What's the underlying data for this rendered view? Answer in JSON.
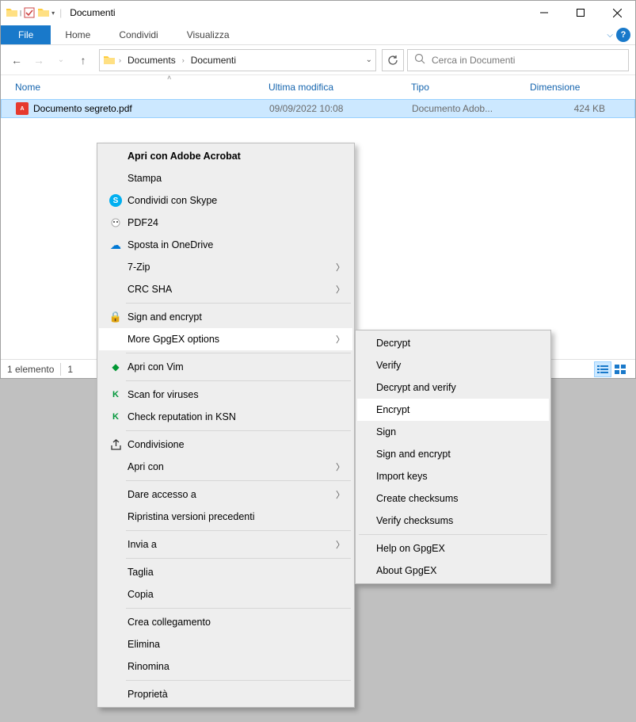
{
  "window": {
    "title": "Documenti",
    "qat_separator": "|"
  },
  "ribbon": {
    "file": "File",
    "tabs": [
      "Home",
      "Condividi",
      "Visualizza"
    ]
  },
  "nav": {
    "breadcrumb": [
      "Documents",
      "Documenti"
    ],
    "search_placeholder": "Cerca in Documenti"
  },
  "columns": {
    "name": "Nome",
    "modified": "Ultima modifica",
    "type": "Tipo",
    "size": "Dimensione"
  },
  "files": [
    {
      "name": "Documento segreto.pdf",
      "modified": "09/09/2022 10:08",
      "type": "Documento Adob...",
      "size": "424 KB"
    }
  ],
  "status": {
    "left1": "1 elemento",
    "left2": "1"
  },
  "context_menu": {
    "items": [
      {
        "label": "Apri con Adobe Acrobat",
        "bold": true
      },
      {
        "label": "Stampa"
      },
      {
        "label": "Condividi con Skype",
        "icon": "skype"
      },
      {
        "label": "PDF24",
        "icon": "pdf24"
      },
      {
        "label": "Sposta in OneDrive",
        "icon": "onedrive"
      },
      {
        "label": "7-Zip",
        "submenu": true
      },
      {
        "label": "CRC SHA",
        "submenu": true
      },
      {
        "sep": true
      },
      {
        "label": "Sign and encrypt",
        "icon": "lock"
      },
      {
        "label": "More GpgEX options",
        "submenu": true,
        "highlight": true
      },
      {
        "sep": true
      },
      {
        "label": "Apri con Vim",
        "icon": "vim"
      },
      {
        "sep": true
      },
      {
        "label": "Scan for viruses",
        "icon": "kaspersky"
      },
      {
        "label": "Check reputation in KSN",
        "icon": "kaspersky"
      },
      {
        "sep": true
      },
      {
        "label": "Condivisione",
        "icon": "share"
      },
      {
        "label": "Apri con",
        "submenu": true
      },
      {
        "sep": true
      },
      {
        "label": "Dare accesso a",
        "submenu": true
      },
      {
        "label": "Ripristina versioni precedenti"
      },
      {
        "sep": true
      },
      {
        "label": "Invia a",
        "submenu": true
      },
      {
        "sep": true
      },
      {
        "label": "Taglia"
      },
      {
        "label": "Copia"
      },
      {
        "sep": true
      },
      {
        "label": "Crea collegamento"
      },
      {
        "label": "Elimina"
      },
      {
        "label": "Rinomina"
      },
      {
        "sep": true
      },
      {
        "label": "Proprietà"
      }
    ]
  },
  "submenu": {
    "items": [
      {
        "label": "Decrypt"
      },
      {
        "label": "Verify"
      },
      {
        "label": "Decrypt and verify"
      },
      {
        "label": "Encrypt",
        "highlight": true
      },
      {
        "label": "Sign"
      },
      {
        "label": "Sign and encrypt"
      },
      {
        "label": "Import keys"
      },
      {
        "label": "Create checksums"
      },
      {
        "label": "Verify checksums"
      },
      {
        "sep": true
      },
      {
        "label": "Help on GpgEX"
      },
      {
        "label": "About GpgEX"
      }
    ]
  }
}
